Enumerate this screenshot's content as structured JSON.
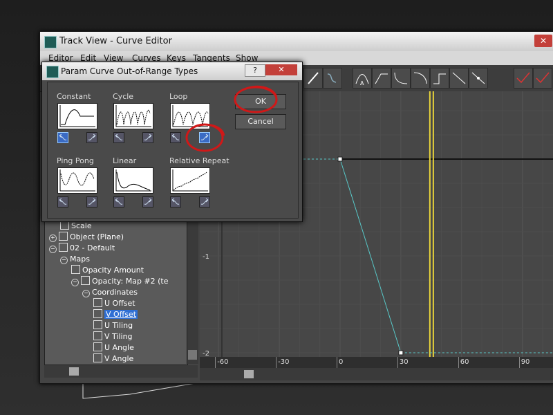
{
  "track_view": {
    "title": "Track View - Curve Editor",
    "menu": [
      "Editor",
      "Edit",
      "View",
      "Curves",
      "Keys",
      "Tangents",
      "Show"
    ],
    "close_label": "✕"
  },
  "tree": {
    "items": [
      {
        "label": "Scale",
        "indent": 2,
        "icon": "scale-icon",
        "toggle": ""
      },
      {
        "label": "Object (Plane)",
        "indent": 1,
        "icon": "plane-object-icon",
        "toggle": "+"
      },
      {
        "label": "02 - Default",
        "indent": 1,
        "icon": "material-icon",
        "toggle": "−"
      },
      {
        "label": "Maps",
        "indent": 2,
        "icon": "",
        "toggle": "−"
      },
      {
        "label": "Opacity Amount",
        "indent": 3,
        "icon": "track-icon",
        "toggle": ""
      },
      {
        "label": "Opacity: Map #2 (te",
        "indent": 3,
        "icon": "map-icon",
        "toggle": "−"
      },
      {
        "label": "Coordinates",
        "indent": 4,
        "icon": "",
        "toggle": "−"
      },
      {
        "label": "U Offset",
        "indent": 5,
        "icon": "track-icon",
        "toggle": ""
      },
      {
        "label": "V Offset",
        "indent": 5,
        "icon": "track-icon",
        "toggle": "",
        "selected": true
      },
      {
        "label": "U Tiling",
        "indent": 5,
        "icon": "track-icon",
        "toggle": ""
      },
      {
        "label": "V Tiling",
        "indent": 5,
        "icon": "track-icon",
        "toggle": ""
      },
      {
        "label": "U Angle",
        "indent": 5,
        "icon": "track-icon",
        "toggle": ""
      },
      {
        "label": "V Angle",
        "indent": 5,
        "icon": "track-icon",
        "toggle": ""
      }
    ]
  },
  "graph": {
    "y_labels": [
      "-1",
      "-2"
    ],
    "x_labels": [
      "-60",
      "-30",
      "0",
      "30",
      "60",
      "90"
    ],
    "curve_color": "#58c8c8",
    "time_slider_color": "#e8d43a",
    "keys": [
      {
        "frame": 0,
        "value": 0
      },
      {
        "frame": 30,
        "value": -2
      }
    ],
    "time_slider_frame": 45
  },
  "dialog": {
    "title": "Param Curve Out-of-Range Types",
    "help_label": "?",
    "close_label": "✕",
    "types": [
      {
        "label": "Constant",
        "in_active": true,
        "out_active": false
      },
      {
        "label": "Cycle",
        "in_active": false,
        "out_active": false
      },
      {
        "label": "Loop",
        "in_active": false,
        "out_active": true
      },
      {
        "label": "Ping Pong",
        "in_active": false,
        "out_active": false
      },
      {
        "label": "Linear",
        "in_active": false,
        "out_active": false
      },
      {
        "label": "Relative Repeat",
        "in_active": false,
        "out_active": false
      }
    ],
    "ok_label": "OK",
    "cancel_label": "Cancel"
  },
  "annotation_color": "#d01818"
}
